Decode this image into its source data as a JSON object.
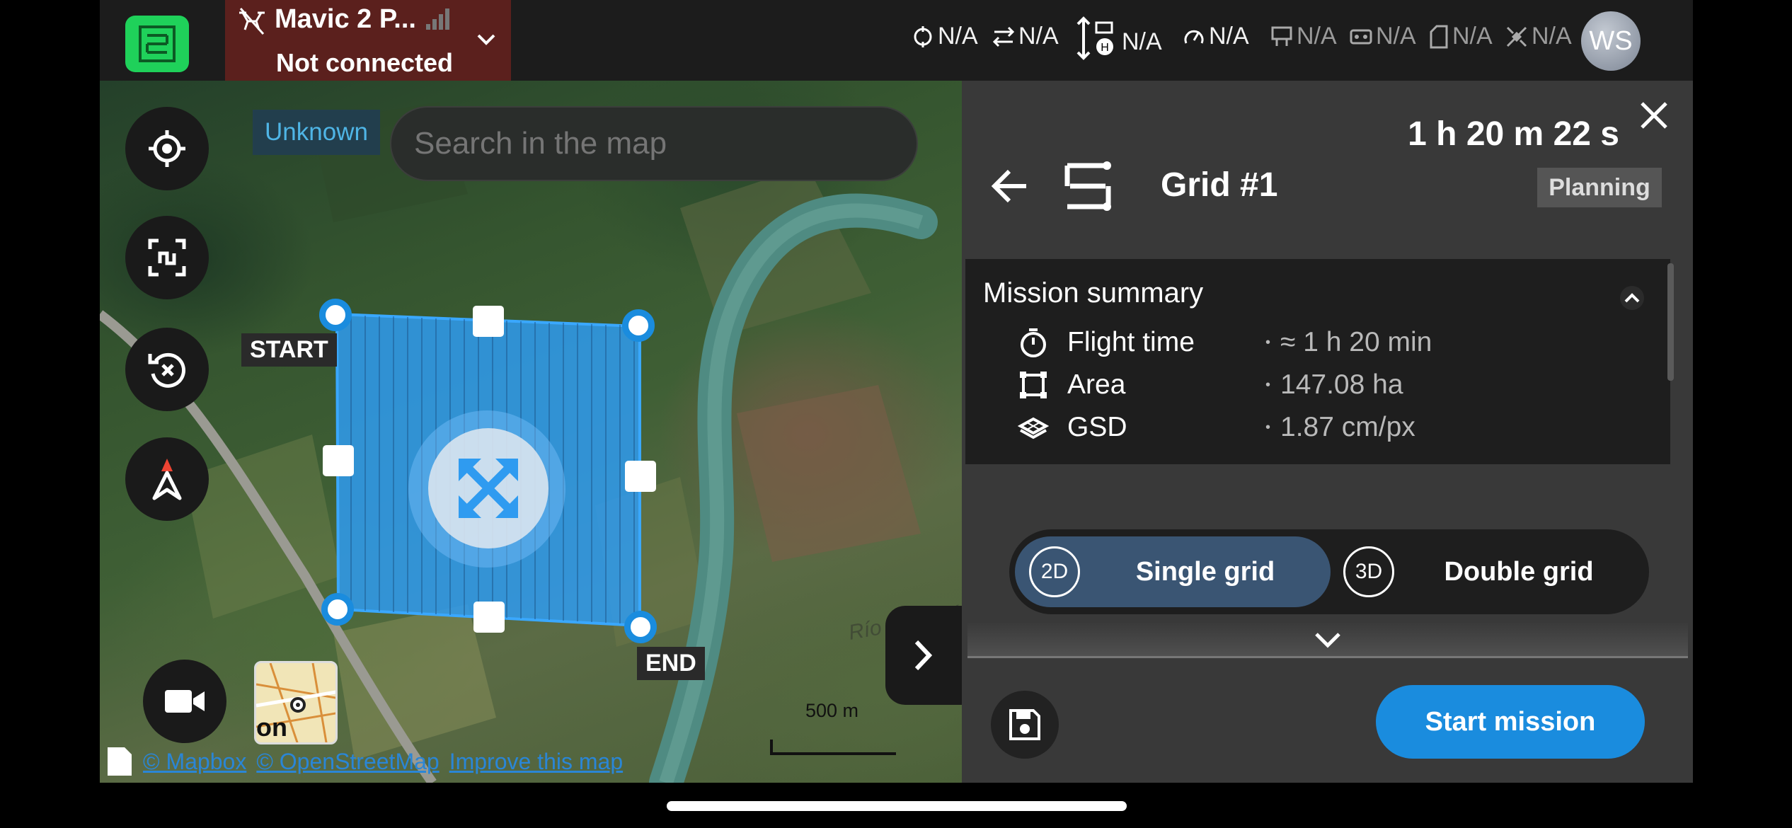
{
  "colors": {
    "accent_blue": "#1a8cde",
    "logo_green": "#1fd15a",
    "disconnected_red": "#5b201d",
    "grid_fill": "#2f9bf0"
  },
  "topbar": {
    "drone_name": "Mavic 2 P...",
    "connection_status": "Not connected",
    "avatar_initials": "WS",
    "status_items": [
      {
        "icon": "gps-drone-icon",
        "value": "N/A"
      },
      {
        "icon": "distance-icon",
        "value": "N/A"
      },
      {
        "icon": "height-home-icon",
        "value": "N/A"
      },
      {
        "icon": "speed-icon",
        "value": "N/A"
      },
      {
        "icon": "drone-battery-icon",
        "value": "N/A"
      },
      {
        "icon": "remote-controller-icon",
        "value": "N/A"
      },
      {
        "icon": "sd-card-icon",
        "value": "N/A"
      },
      {
        "icon": "satellite-icon",
        "value": "N/A"
      }
    ]
  },
  "map": {
    "unknown_tag": "Unknown",
    "search_placeholder": "Search in the map",
    "start_label": "START",
    "end_label": "END",
    "scale_label": "500 m",
    "minimap_text": "on",
    "attribution": {
      "mapbox": "© Mapbox",
      "osm": "© OpenStreetMap",
      "improve": "Improve this map"
    },
    "watermark": "Río Lacantún"
  },
  "panel": {
    "duration": "1 h 20 m 22 s",
    "title": "Grid #1",
    "status_badge": "Planning",
    "summary": {
      "title": "Mission summary",
      "rows": [
        {
          "icon": "stopwatch-icon",
          "label": "Flight time",
          "value": "≈ 1 h 20 min"
        },
        {
          "icon": "area-icon",
          "label": "Area",
          "value": "147.08 ha"
        },
        {
          "icon": "gsd-icon",
          "label": "GSD",
          "value": "1.87 cm/px"
        }
      ]
    },
    "grid_toggle": {
      "single_badge": "2D",
      "single_label": "Single grid",
      "double_badge": "3D",
      "double_label": "Double grid",
      "selected": "Single grid"
    },
    "start_button": "Start mission"
  }
}
